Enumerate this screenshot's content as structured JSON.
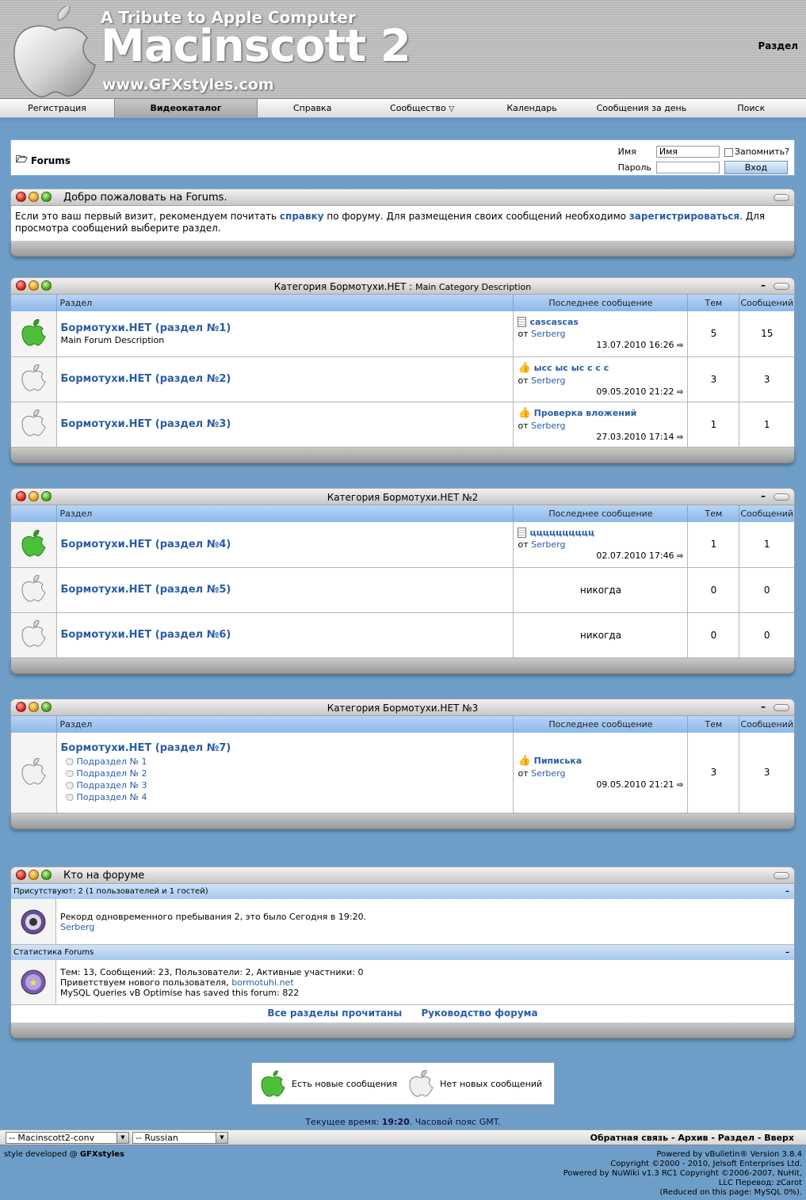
{
  "header": {
    "tribute": "A Tribute to Apple Computer",
    "name": "Macinscott 2",
    "www": "www.GFXstyles.com",
    "right_label": "Раздел"
  },
  "nav": [
    "Регистрация",
    "Видеокаталог",
    "Справка",
    "Сообщество",
    "Календарь",
    "Сообщения за день",
    "Поиск"
  ],
  "breadcrumb": {
    "title": "Forums"
  },
  "login": {
    "name_label": "Имя",
    "name_value": "Имя",
    "password_label": "Пароль",
    "remember_label": "Запомнить?",
    "login_button": "Вход"
  },
  "welcome": {
    "title": "Добро пожаловать на Forums.",
    "text1": "Если это ваш первый визит, рекомендуем почитать ",
    "link1": "справку",
    "text2": " по форуму. Для размещения своих сообщений необходимо ",
    "link2": "зарегистрироваться",
    "text3": ". Для просмотра сообщений выберите раздел."
  },
  "columns": {
    "forum": "Раздел",
    "last_post": "Последнее сообщение",
    "threads": "Тем",
    "posts": "Сообщений"
  },
  "categories": [
    {
      "title": "Категория Бормотухи.НЕТ",
      "sep": " : ",
      "desc": "Main Category Description",
      "forums": [
        {
          "name": "Бормотухи.НЕТ (раздел №1)",
          "desc": "Main Forum Description",
          "new": true,
          "last_title": "cascascas",
          "last_icon": "doc",
          "by_label": "от ",
          "by": "Serberg",
          "date": "13.07.2010",
          "time": "16:26",
          "threads": "5",
          "posts": "15"
        },
        {
          "name": "Бормотухи.НЕТ (раздел №2)",
          "desc": "",
          "new": false,
          "last_title": "ысс ыс ыс с с с",
          "last_icon": "thumb",
          "by_label": "от ",
          "by": "Serberg",
          "date": "09.05.2010",
          "time": "21:22",
          "threads": "3",
          "posts": "3"
        },
        {
          "name": "Бормотухи.НЕТ (раздел №3)",
          "desc": "",
          "new": false,
          "last_title": "Проверка вложений",
          "last_icon": "thumb",
          "by_label": "от ",
          "by": "Serberg",
          "date": "27.03.2010",
          "time": "17:14",
          "threads": "1",
          "posts": "1"
        }
      ]
    },
    {
      "title": "Категория Бормотухи.НЕТ №2",
      "forums": [
        {
          "name": "Бормотухи.НЕТ (раздел №4)",
          "new": true,
          "last_title": "цццццццццц",
          "last_icon": "doc",
          "by_label": "от ",
          "by": "Serberg",
          "date": "02.07.2010",
          "time": "17:46",
          "threads": "1",
          "posts": "1"
        },
        {
          "name": "Бормотухи.НЕТ (раздел №5)",
          "new": false,
          "never": "никогда",
          "threads": "0",
          "posts": "0"
        },
        {
          "name": "Бормотухи.НЕТ (раздел №6)",
          "new": false,
          "never": "никогда",
          "threads": "0",
          "posts": "0"
        }
      ]
    },
    {
      "title": "Категория Бормотухи.НЕТ №3",
      "forums": [
        {
          "name": "Бормотухи.НЕТ (раздел №7)",
          "new": false,
          "subforums": [
            "Подраздел № 1",
            "Подраздел № 2",
            "Подраздел № 3",
            "Подраздел № 4"
          ],
          "last_title": "Пиписька",
          "last_icon": "thumb",
          "by_label": "от ",
          "by": "Serberg",
          "date": "09.05.2010",
          "time": "21:21",
          "threads": "3",
          "posts": "3"
        }
      ]
    }
  ],
  "online": {
    "title": "Кто на форуме",
    "present_label": "Присутствуют:",
    "present_value": "2 (1 пользователей и 1 гостей)",
    "record": "Рекорд одновременного пребывания 2, это было Сегодня в 19:20.",
    "user": "Serberg",
    "stats_label": "Статистика Forums",
    "stats_line": "Тем: 13, Сообщений: 23, Пользователи: 2, Активные участники: 0",
    "welcome_new": "Приветствуем нового пользователя, ",
    "new_user": "bormotuhi.net",
    "mysql": "MySQL Queries vB Optimise has saved this forum: 822",
    "mark_read": "Все разделы прочитаны",
    "guide": "Руководство форума"
  },
  "legend": {
    "new": "Есть новые сообщения",
    "none": "Нет новых сообщений"
  },
  "time": {
    "prefix": "Текущее время: ",
    "value": "19:20",
    "suffix": ". Часовой пояс GMT."
  },
  "bottombar": {
    "style_select": "-- Macinscott2-conv",
    "lang_select": "-- Russian",
    "links": "Обратная связь - Архив - Раздел - Вверх"
  },
  "footer": {
    "left_prefix": "style developed @ ",
    "left_brand": "GFXstyles",
    "right": [
      "Powered by vBulletin® Version 3.8.4",
      "Copyright ©2000 - 2010, Jelsoft Enterprises Ltd.",
      "Powered by NuWiki v1.3 RC1 Copyright ©2006-2007, NuHit,",
      "LLC Перевод: zCarot",
      "(Reduced on this page: MySQL 0%)."
    ]
  },
  "colors": {
    "background": "#6e9ec8",
    "link": "#2a5da6",
    "header_blue": "#a7c9ee"
  }
}
